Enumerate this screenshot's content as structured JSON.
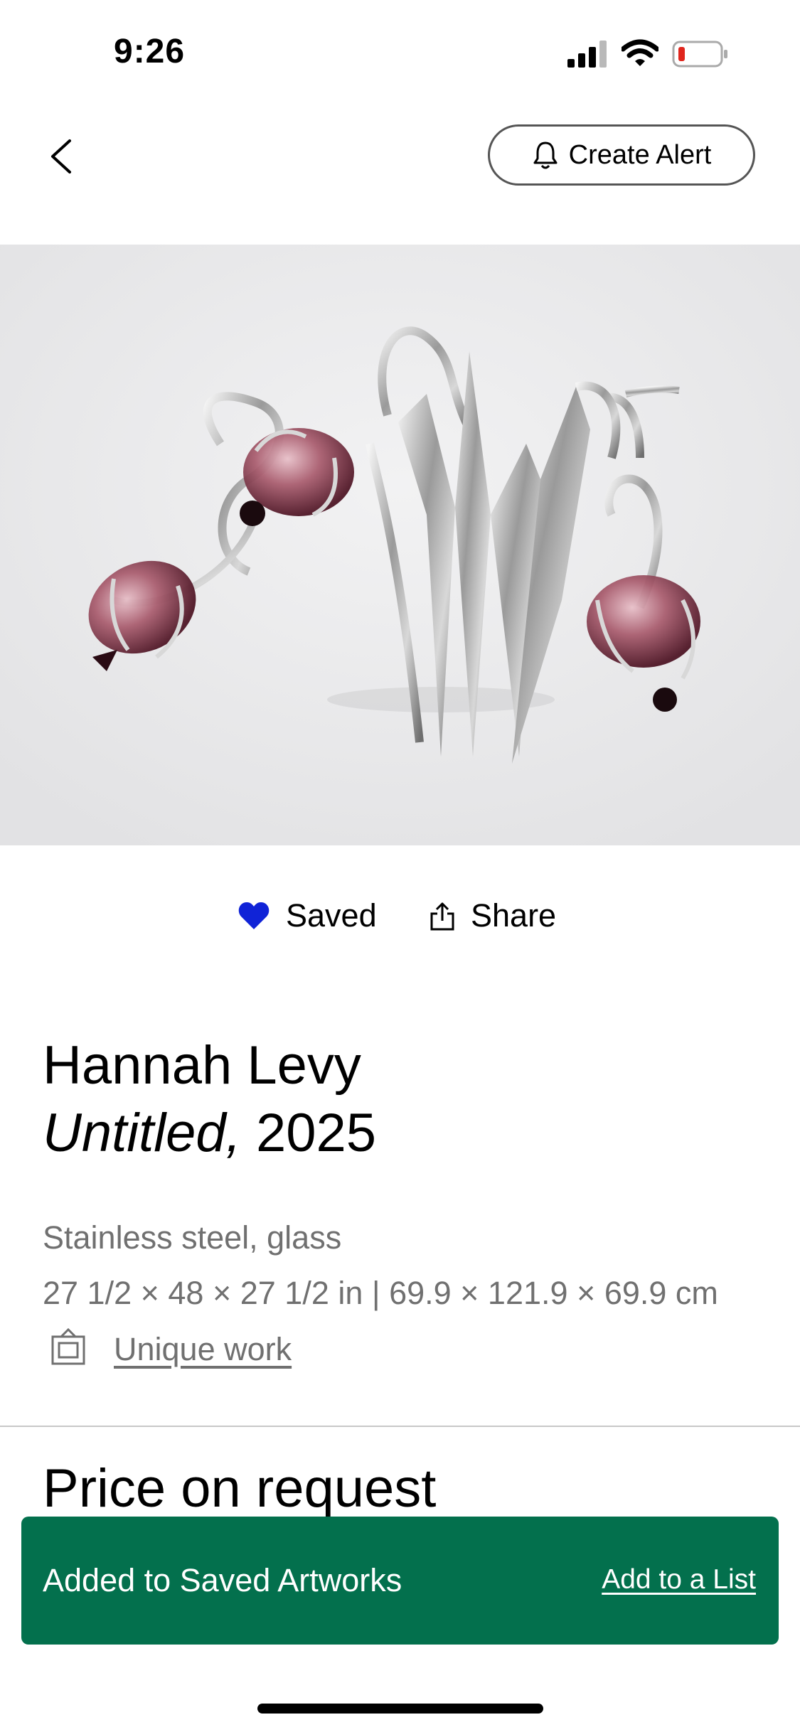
{
  "status_bar": {
    "time": "9:26",
    "battery_color": "#e0261d"
  },
  "header": {
    "back_icon": "chevron-left-icon",
    "alert_label": "Create Alert",
    "alert_icon": "bell-icon"
  },
  "artwork_image": {
    "description_icon": "artwork-image"
  },
  "actions": {
    "saved_label": "Saved",
    "saved_icon": "heart-icon",
    "saved_color": "#1023d7",
    "share_label": "Share",
    "share_icon": "share-icon"
  },
  "artwork": {
    "artist": "Hannah Levy",
    "title": "Untitled,",
    "year": "2025",
    "medium": "Stainless steel, glass",
    "dimensions": "27 1/2 × 48 × 27 1/2 in | 69.9 × 121.9 × 69.9 cm",
    "unique_label": "Unique work",
    "price": "Price on request"
  },
  "toast": {
    "message": "Added to Saved Artworks",
    "link": "Add to a List",
    "color": "#03704d"
  }
}
